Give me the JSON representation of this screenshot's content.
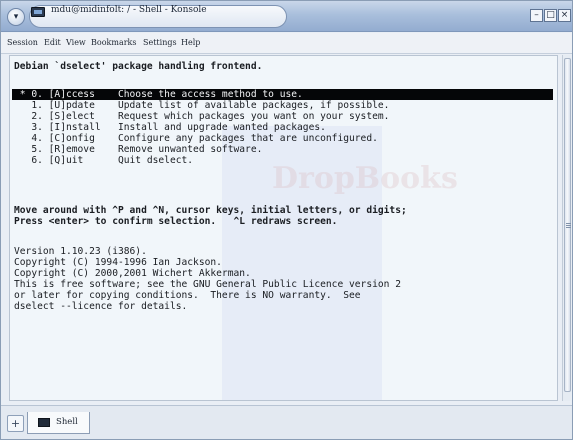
{
  "window": {
    "title": "mdu@midinfolt: / - Shell - Konsole",
    "menu_glyph": "▾",
    "buttons": {
      "minimize": "–",
      "maximize": "□",
      "close": "×"
    }
  },
  "menubar": {
    "items": [
      "Session",
      "Edit",
      "View",
      "Bookmarks",
      "Settings",
      "Help"
    ]
  },
  "terminal": {
    "header": "Debian `dselect' package handling frontend.",
    "menu": [
      {
        "text": " * 0. [A]ccess    Choose the access method to use.",
        "selected": true
      },
      {
        "text": "   1. [U]pdate    Update list of available packages, if possible.",
        "selected": false
      },
      {
        "text": "   2. [S]elect    Request which packages you want on your system.",
        "selected": false
      },
      {
        "text": "   3. [I]nstall   Install and upgrade wanted packages.",
        "selected": false
      },
      {
        "text": "   4. [C]onfig    Configure any packages that are unconfigured.",
        "selected": false
      },
      {
        "text": "   5. [R]emove    Remove unwanted software.",
        "selected": false
      },
      {
        "text": "   6. [Q]uit      Quit dselect.",
        "selected": false
      }
    ],
    "help_lines": [
      "Move around with ^P and ^N, cursor keys, initial letters, or digits;",
      "Press <enter> to confirm selection.   ^L redraws screen."
    ],
    "info_lines": [
      "Version 1.10.23 (i386).",
      "Copyright (C) 1994-1996 Ian Jackson.",
      "Copyright (C) 2000,2001 Wichert Akkerman.",
      "This is free software; see the GNU General Public Licence version 2",
      "or later for copying conditions.  There is NO warranty.  See",
      "dselect --licence for details."
    ],
    "watermark": "DropBooks"
  },
  "tabbar": {
    "new_tab_glyph": "+",
    "tab_label": "Shell"
  }
}
